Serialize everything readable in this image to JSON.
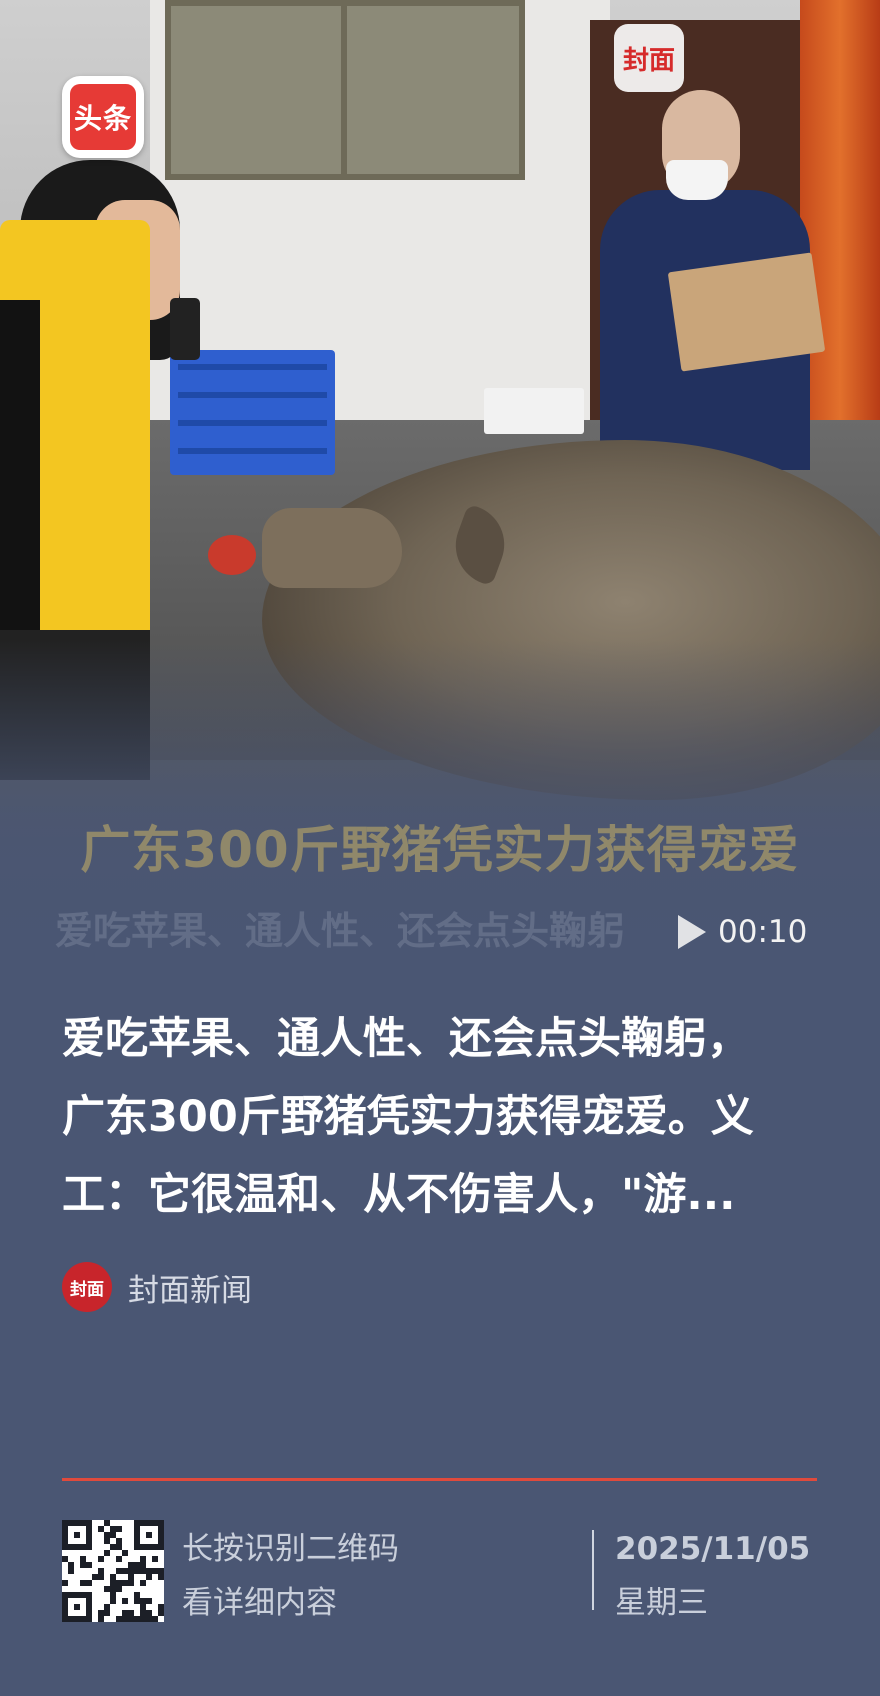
{
  "app": {
    "logo_text": "头条"
  },
  "video": {
    "watermark_text": "封面",
    "caption_line1": "广东300斤野猪凭实力获得宠爱",
    "caption_line2": "爱吃苹果、通人性、还会点头鞠躬",
    "duration": "00:10"
  },
  "article": {
    "headline_lines": [
      "爱吃苹果、通人性、还会点头鞠躬，",
      "广东300斤野猪凭实力获得宠爱。义",
      "工：它很温和、从不伤害人，\"游..."
    ],
    "source_logo_text": "封面",
    "source_name": "封面新闻"
  },
  "footer": {
    "qr_hint_line1": "长按识别二维码",
    "qr_hint_line2": "看详细内容",
    "date": "2025/11/05",
    "weekday": "星期三"
  },
  "colors": {
    "background": "#4a5673",
    "accent_red": "#e04a3c",
    "toutiao_red": "#e63a36"
  }
}
